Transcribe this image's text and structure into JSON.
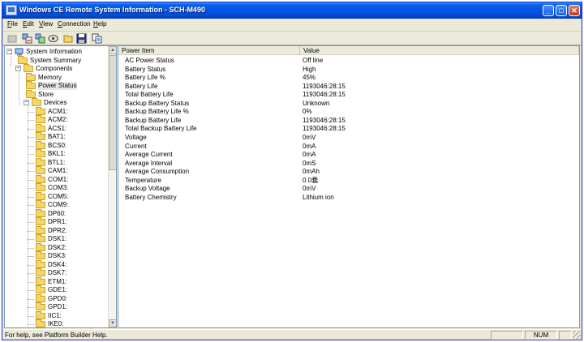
{
  "window": {
    "title": "Windows CE Remote System Information - SCH-M490",
    "controls": [
      "_",
      "□",
      "✕"
    ]
  },
  "menu": [
    "File",
    "Edit",
    "View",
    "Connection",
    "Help"
  ],
  "toolbar": [
    "connect-icon",
    "refresh-icon",
    "device-icon",
    "network-icon",
    "open-icon",
    "save-icon",
    "copy-icon"
  ],
  "tree": {
    "root": "System Information",
    "system_summary": "System Summary",
    "components": "Components",
    "memory": "Memory",
    "power_status": "Power Status",
    "store": "Store",
    "devices": "Devices",
    "device_items": [
      "ACM1:",
      "ACM2:",
      "ACS1:",
      "BAT1:",
      "BCS0:",
      "BKL1:",
      "BTL1:",
      "CAM1:",
      "COM1:",
      "COM3:",
      "COM5:",
      "COM9:",
      "DP60:",
      "DPR1:",
      "DPR2:",
      "DSK1:",
      "DSK2:",
      "DSK3:",
      "DSK4:",
      "DSK7:",
      "ETM1:",
      "GDE1:",
      "GPD0:",
      "GPD1:",
      "IIC1:",
      "IKE0:"
    ]
  },
  "list": {
    "columns": [
      "Power Item",
      "Value"
    ],
    "rows": [
      [
        "AC Power Status",
        "Off line"
      ],
      [
        "Battery Status",
        "High"
      ],
      [
        "Battery Life %",
        "45%"
      ],
      [
        "Battery Life",
        "1193046:28:15"
      ],
      [
        "Total Battery Life",
        "1193046:28:15"
      ],
      [
        "Backup Battery Status",
        "Unknown"
      ],
      [
        "Backup Battery Life %",
        "0%"
      ],
      [
        "Backup Battery Life",
        "1193046:28:15"
      ],
      [
        "Total Backup Battery Life",
        "1193046:28:15"
      ],
      [
        "Voltage",
        "0mV"
      ],
      [
        "Current",
        "0mA"
      ],
      [
        "Average Current",
        "0mA"
      ],
      [
        "Average Interval",
        "0mS"
      ],
      [
        "Average Consumption",
        "0mAh"
      ],
      [
        "Temperature",
        "0.0蠢"
      ],
      [
        "Backup Voltage",
        "0mV"
      ],
      [
        "Battery Chemistry",
        "Lithium ion"
      ]
    ]
  },
  "status": {
    "help": "For help, see Platform Builder Help.",
    "num": "NUM"
  }
}
